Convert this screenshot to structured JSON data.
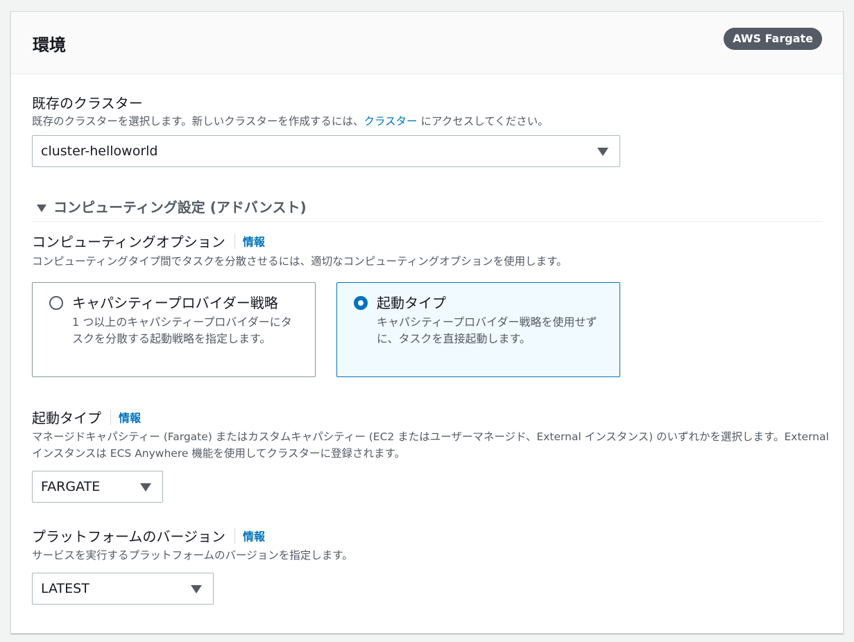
{
  "header": {
    "title": "環境",
    "badge": "AWS Fargate"
  },
  "cluster": {
    "label": "既存のクラスター",
    "description_before": "既存のクラスターを選択します。新しいクラスターを作成するには、",
    "description_link": "クラスター",
    "description_after": " にアクセスしてください。",
    "value": "cluster-helloworld"
  },
  "compute_settings": {
    "expander_label": "コンピューティング設定 (アドバンスト)",
    "option": {
      "label": "コンピューティングオプション",
      "info": "情報",
      "description": "コンピューティングタイプ間でタスクを分散させるには、適切なコンピューティングオプションを使用します。"
    },
    "tiles": [
      {
        "title": "キャパシティープロバイダー戦略",
        "description": "1 つ以上のキャパシティープロバイダーにタスクを分散する起動戦略を指定します。",
        "selected": false
      },
      {
        "title": "起動タイプ",
        "description": "キャパシティープロバイダー戦略を使用せずに、タスクを直接起動します。",
        "selected": true
      }
    ]
  },
  "launch_type": {
    "label": "起動タイプ",
    "info": "情報",
    "description": "マネージドキャパシティー (Fargate) またはカスタムキャパシティー (EC2 またはユーザーマネージド、External インスタンス) のいずれかを選択します。External インスタンスは ECS Anywhere 機能を使用してクラスターに登録されます。",
    "value": "FARGATE"
  },
  "platform_version": {
    "label": "プラットフォームのバージョン",
    "info": "情報",
    "description": "サービスを実行するプラットフォームのバージョンを指定します。",
    "value": "LATEST"
  },
  "colors": {
    "accent": "#0073bb",
    "selected_tile_bg": "#f1faff",
    "badge_bg": "#545b64"
  }
}
